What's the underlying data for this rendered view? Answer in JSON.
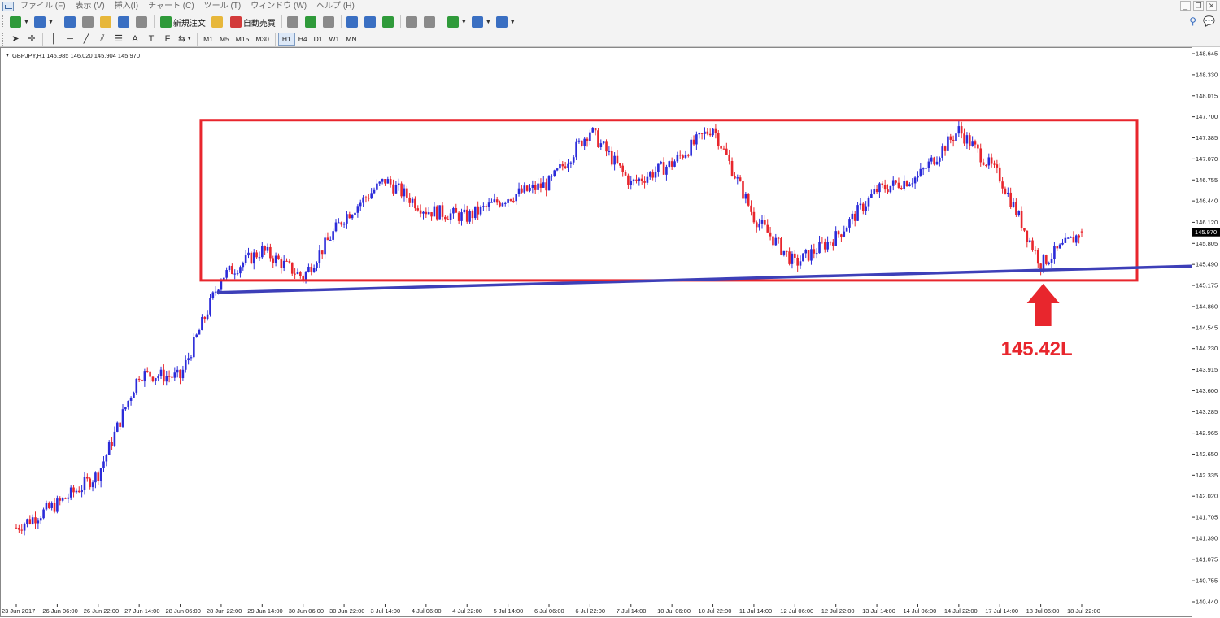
{
  "menu": [
    "ファイル (F)",
    "表示 (V)",
    "挿入(I)",
    "チャート (C)",
    "ツール (T)",
    "ウィンドウ (W)",
    "ヘルプ (H)"
  ],
  "toolbar": {
    "new_order": "新規注文",
    "auto_trading": "自動売買",
    "drawing_tools": [
      "A",
      "T",
      "F"
    ],
    "timeframes": [
      "M1",
      "M5",
      "M15",
      "M30",
      "H1",
      "H4",
      "D1",
      "W1",
      "MN"
    ],
    "active_timeframe": "H1"
  },
  "chart": {
    "header": "GBPJPY,H1  145.985 146.020 145.904 145.970",
    "current_price_label": "145.970",
    "annotation": "145.42L",
    "colors": {
      "bull_candle": "#2b2bd9",
      "bear_candle": "#e8262d",
      "range_box": "#e8262d",
      "support_line": "#3d3fb8",
      "arrow": "#e8262d",
      "price_tag": "#000000"
    }
  },
  "chart_data": {
    "type": "candlestick",
    "symbol": "GBPJPY",
    "timeframe": "H1",
    "y_ticks": [
      "148.645",
      "148.330",
      "148.015",
      "147.700",
      "147.385",
      "147.070",
      "146.755",
      "146.440",
      "146.120",
      "145.805",
      "145.490",
      "145.175",
      "144.860",
      "144.545",
      "144.230",
      "143.915",
      "143.600",
      "143.285",
      "142.965",
      "142.650",
      "142.335",
      "142.020",
      "141.705",
      "141.390",
      "141.075",
      "140.755",
      "140.440"
    ],
    "x_ticks": [
      "23 Jun 2017",
      "26 Jun 06:00",
      "26 Jun 22:00",
      "27 Jun 14:00",
      "28 Jun 06:00",
      "28 Jun 22:00",
      "29 Jun 14:00",
      "30 Jun 06:00",
      "30 Jun 22:00",
      "3 Jul 14:00",
      "4 Jul 06:00",
      "4 Jul 22:00",
      "5 Jul 14:00",
      "6 Jul 06:00",
      "6 Jul 22:00",
      "7 Jul 14:00",
      "10 Jul 06:00",
      "10 Jul 22:00",
      "11 Jul 14:00",
      "12 Jul 06:00",
      "12 Jul 22:00",
      "13 Jul 14:00",
      "14 Jul 06:00",
      "14 Jul 22:00",
      "17 Jul 14:00",
      "18 Jul 06:00",
      "18 Jul 22:00"
    ],
    "ylim": [
      140.44,
      148.645
    ],
    "last": {
      "open": 145.985,
      "high": 146.02,
      "low": 145.904,
      "close": 145.97
    },
    "range_box": {
      "high": 147.65,
      "low": 145.25
    },
    "support_line": [
      {
        "x": "28 Jun 22:00",
        "y": 145.07
      },
      {
        "x": "18 Jul 22:00",
        "y": 145.42
      }
    ],
    "price_path": [
      {
        "x": "23 Jun 2017",
        "y": 141.55
      },
      {
        "x": "26 Jun 06:00",
        "y": 141.9
      },
      {
        "x": "26 Jun 22:00",
        "y": 142.35
      },
      {
        "x": "27 Jun 14:00",
        "y": 143.85
      },
      {
        "x": "28 Jun 06:00",
        "y": 143.8
      },
      {
        "x": "28 Jun 22:00",
        "y": 145.3
      },
      {
        "x": "29 Jun 14:00",
        "y": 145.7
      },
      {
        "x": "30 Jun 06:00",
        "y": 145.3
      },
      {
        "x": "30 Jun 22:00",
        "y": 146.2
      },
      {
        "x": "3 Jul 14:00",
        "y": 146.75
      },
      {
        "x": "4 Jul 06:00",
        "y": 146.3
      },
      {
        "x": "4 Jul 22:00",
        "y": 146.2
      },
      {
        "x": "5 Jul 14:00",
        "y": 146.5
      },
      {
        "x": "6 Jul 06:00",
        "y": 146.7
      },
      {
        "x": "6 Jul 22:00",
        "y": 147.5
      },
      {
        "x": "7 Jul 14:00",
        "y": 146.7
      },
      {
        "x": "10 Jul 06:00",
        "y": 147.0
      },
      {
        "x": "10 Jul 22:00",
        "y": 147.55
      },
      {
        "x": "11 Jul 14:00",
        "y": 146.2
      },
      {
        "x": "12 Jul 06:00",
        "y": 145.5
      },
      {
        "x": "12 Jul 22:00",
        "y": 145.9
      },
      {
        "x": "13 Jul 14:00",
        "y": 146.6
      },
      {
        "x": "14 Jul 06:00",
        "y": 146.8
      },
      {
        "x": "14 Jul 22:00",
        "y": 147.5
      },
      {
        "x": "17 Jul 14:00",
        "y": 146.8
      },
      {
        "x": "18 Jul 06:00",
        "y": 145.5
      },
      {
        "x": "18 Jul 22:00",
        "y": 145.97
      }
    ]
  }
}
